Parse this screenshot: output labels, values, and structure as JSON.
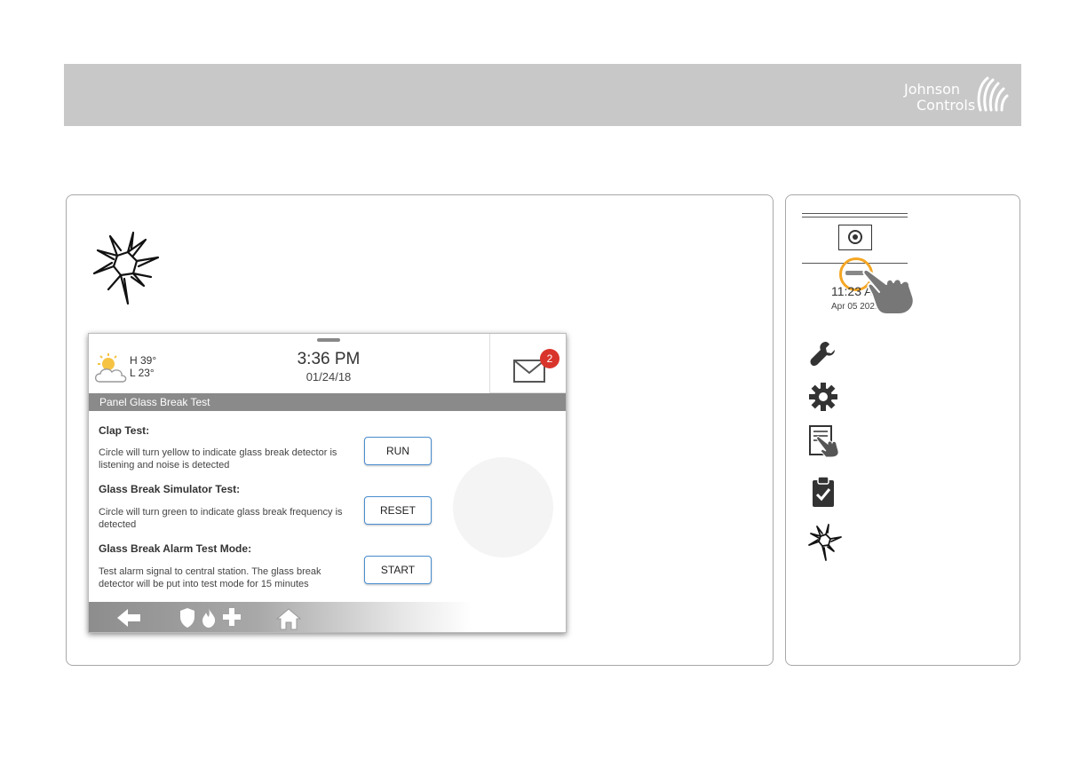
{
  "brand": {
    "line1": "Johnson",
    "line2": "Controls"
  },
  "screen": {
    "weather": {
      "high": "H 39°",
      "low": "L 23°"
    },
    "clock": {
      "time": "3:36 PM",
      "date": "01/24/18"
    },
    "messages": {
      "count": "2"
    },
    "title": "Panel Glass Break Test",
    "tests": [
      {
        "title": "Clap Test:",
        "description": "Circle will turn yellow to indicate glass break detector is listening and noise is detected",
        "button": "RUN"
      },
      {
        "title": "Glass Break Simulator Test:",
        "description": "Circle will turn green to indicate glass break frequency is detected",
        "button": "RESET"
      },
      {
        "title": "Glass Break Alarm Test Mode:",
        "description": "Test alarm signal to central station. The glass break detector will be put into test mode for 15 minutes",
        "button": "START"
      }
    ]
  },
  "side": {
    "time": "11:23 AM",
    "date": "Apr 05 2021",
    "icons": [
      "wrench-icon",
      "gear-icon",
      "panel-touch-icon",
      "clipboard-check-icon",
      "glass-break-icon"
    ]
  },
  "colors": {
    "banner": "#c8c8c8",
    "titlebar": "#8a8a8a",
    "button_border": "#4a8ed0",
    "badge": "#d9342b",
    "highlight": "#f5a623"
  }
}
